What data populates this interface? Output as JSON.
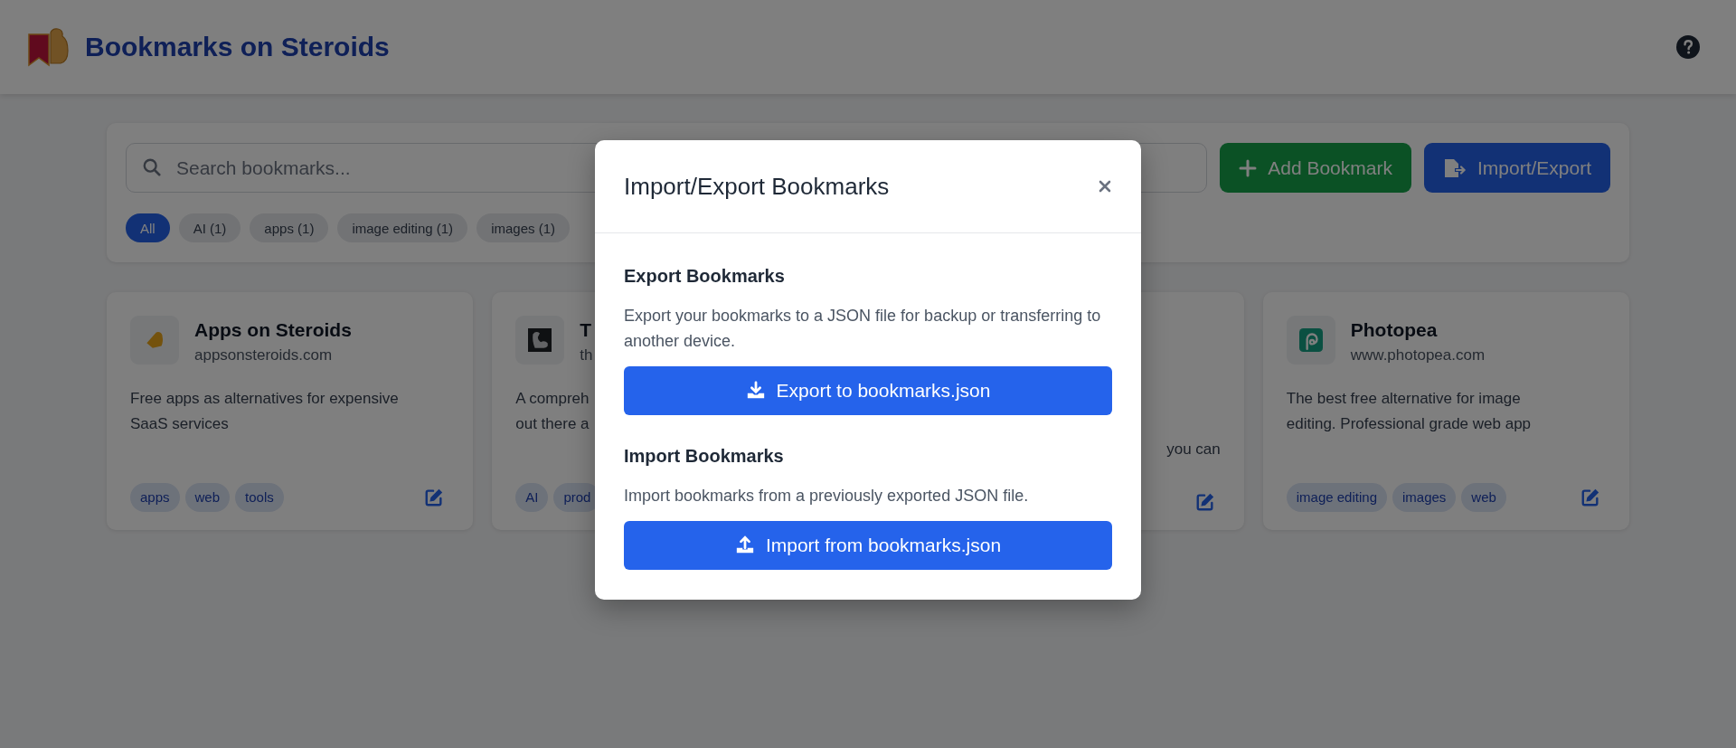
{
  "header": {
    "title": "Bookmarks on Steroids"
  },
  "toolbar": {
    "search": {
      "placeholder": "Search bookmarks..."
    },
    "buttons": [
      {
        "label": "Add Bookmark",
        "kind": "add"
      },
      {
        "label": "Import/Export",
        "kind": "import"
      }
    ]
  },
  "filters": [
    {
      "label": "All",
      "selected": true
    },
    {
      "label": "AI (1)",
      "selected": false
    },
    {
      "label": "apps (1)",
      "selected": false
    },
    {
      "label": "image editing (1)",
      "selected": false
    },
    {
      "label": "images (1)",
      "selected": false
    }
  ],
  "bookmarks": [
    {
      "kind": "arm",
      "title": "Apps on Steroids",
      "url": "appsonsteroids.com",
      "description": [
        "Free apps as alternatives for expensive",
        "SaaS services"
      ],
      "tags": [
        "apps",
        "web",
        "tools"
      ]
    },
    {
      "kind": "dark-arm",
      "title": "T",
      "url": "th",
      "description": [
        "A compreh",
        "out there a"
      ],
      "tags": [
        "AI",
        "prod"
      ]
    },
    {
      "kind": "covered",
      "description": [
        "you can"
      ]
    },
    {
      "kind": "spiral",
      "title": "Photopea",
      "url": "www.photopea.com",
      "description": [
        "The best free alternative for image",
        "editing. Professional grade web app"
      ],
      "tags": [
        "image editing",
        "images",
        "web"
      ]
    }
  ],
  "modal": {
    "title": "Import/Export Bookmarks",
    "sections": [
      {
        "heading": "Export Bookmarks",
        "text": "Export your bookmarks to a JSON file for backup or transferring to another device.",
        "button": {
          "label": "Export to bookmarks.json",
          "kind": "export"
        }
      },
      {
        "heading": "Import Bookmarks",
        "text": "Import bookmarks from a previously exported JSON file.",
        "button": {
          "label": "Import from bookmarks.json",
          "kind": "import"
        }
      }
    ]
  }
}
